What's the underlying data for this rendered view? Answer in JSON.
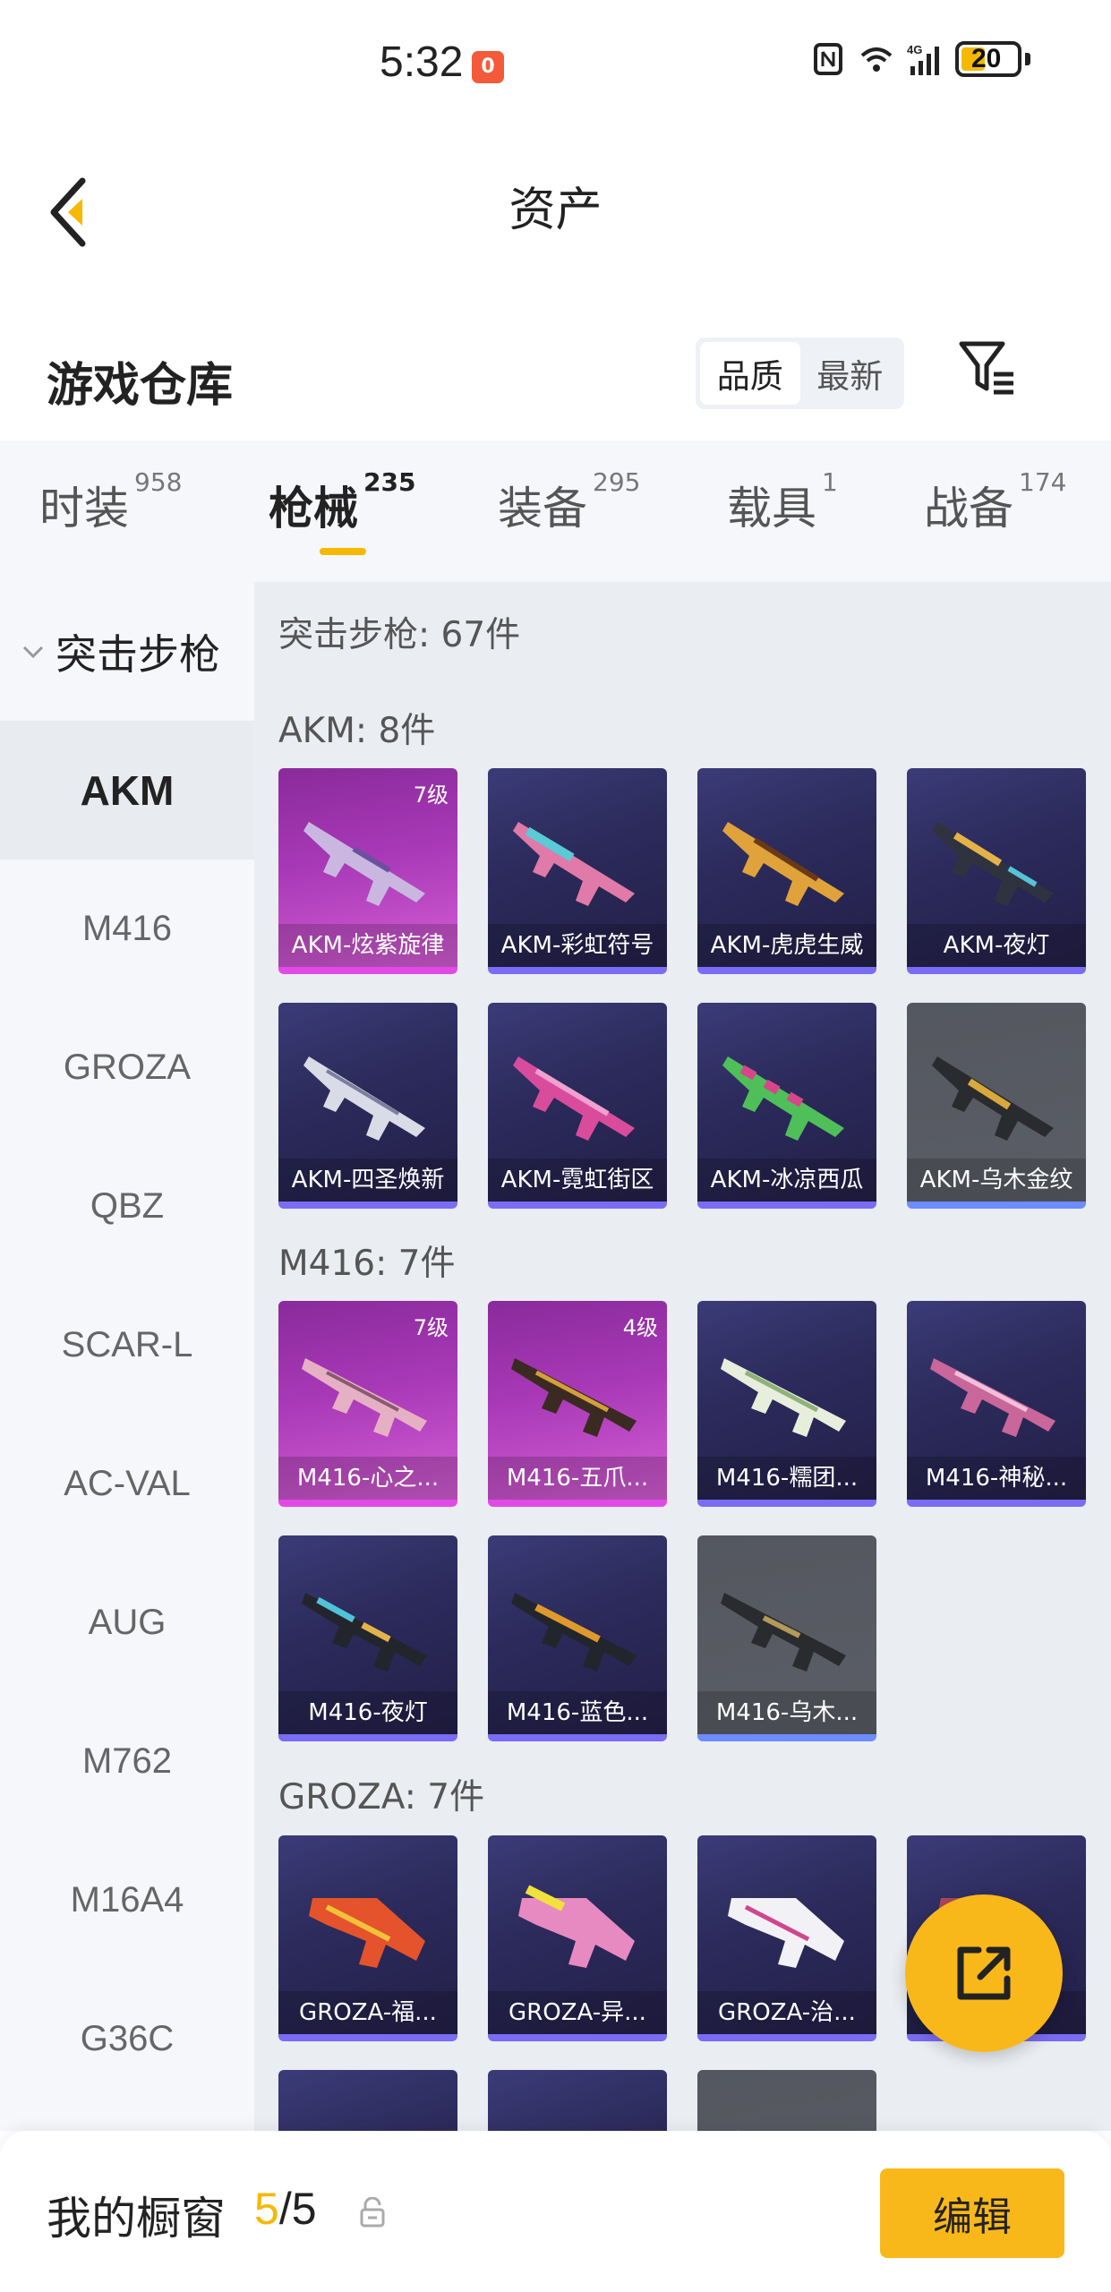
{
  "status_bar": {
    "time": "5:32",
    "record_badge": "0",
    "network": "4G",
    "battery": "20"
  },
  "nav": {
    "title": "资产",
    "back_icon": "back-arrow-icon"
  },
  "warehouse": {
    "title": "游戏仓库",
    "sort_options": [
      "品质",
      "最新"
    ],
    "sort_selected": "品质",
    "filter_icon": "filter-icon"
  },
  "tabs": [
    {
      "label": "时装",
      "count": "958"
    },
    {
      "label": "枪械",
      "count": "235"
    },
    {
      "label": "装备",
      "count": "295"
    },
    {
      "label": "载具",
      "count": "1"
    },
    {
      "label": "战备",
      "count": "174"
    }
  ],
  "active_tab": "枪械",
  "sidebar": {
    "category": "突击步枪",
    "items": [
      "AKM",
      "M416",
      "GROZA",
      "QBZ",
      "SCAR-L",
      "AC-VAL",
      "AUG",
      "M762",
      "M16A4",
      "G36C"
    ],
    "selected": "AKM"
  },
  "content": {
    "category_title": "突击步枪: 67件",
    "groups": [
      {
        "title": "AKM: 8件",
        "items": [
          {
            "name": "AKM-炫紫旋律",
            "level": "7级",
            "rarity": "legendary"
          },
          {
            "name": "AKM-彩虹符号",
            "level": "",
            "rarity": "epic"
          },
          {
            "name": "AKM-虎虎生威",
            "level": "",
            "rarity": "epic"
          },
          {
            "name": "AKM-夜灯",
            "level": "",
            "rarity": "epic"
          },
          {
            "name": "AKM-四圣焕新",
            "level": "",
            "rarity": "epic"
          },
          {
            "name": "AKM-霓虹街区",
            "level": "",
            "rarity": "epic"
          },
          {
            "name": "AKM-冰凉西瓜",
            "level": "",
            "rarity": "epic"
          },
          {
            "name": "AKM-乌木金纹",
            "level": "",
            "rarity": "common"
          }
        ]
      },
      {
        "title": "M416: 7件",
        "items": [
          {
            "name": "M416-心之...",
            "level": "7级",
            "rarity": "legendary"
          },
          {
            "name": "M416-五爪...",
            "level": "4级",
            "rarity": "legendary"
          },
          {
            "name": "M416-糯团...",
            "level": "",
            "rarity": "epic"
          },
          {
            "name": "M416-神秘...",
            "level": "",
            "rarity": "epic"
          },
          {
            "name": "M416-夜灯",
            "level": "",
            "rarity": "epic"
          },
          {
            "name": "M416-蓝色...",
            "level": "",
            "rarity": "epic"
          },
          {
            "name": "M416-乌木...",
            "level": "",
            "rarity": "common"
          }
        ]
      },
      {
        "title": "GROZA: 7件",
        "items": [
          {
            "name": "GROZA-福...",
            "level": "",
            "rarity": "epic"
          },
          {
            "name": "GROZA-异...",
            "level": "",
            "rarity": "epic"
          },
          {
            "name": "GROZA-治...",
            "level": "",
            "rarity": "epic"
          },
          {
            "name": "",
            "level": "",
            "rarity": "epic"
          }
        ]
      }
    ]
  },
  "fab": {
    "icon": "share-export-icon"
  },
  "bottom_bar": {
    "label": "我的橱窗",
    "current": "5",
    "total": "/5",
    "lock_icon": "lock-icon",
    "edit_label": "编辑"
  },
  "colors": {
    "accent": "#f9b81a",
    "epic": "#2b2a5a",
    "legendary": "#a839b6",
    "common": "#585b63"
  }
}
